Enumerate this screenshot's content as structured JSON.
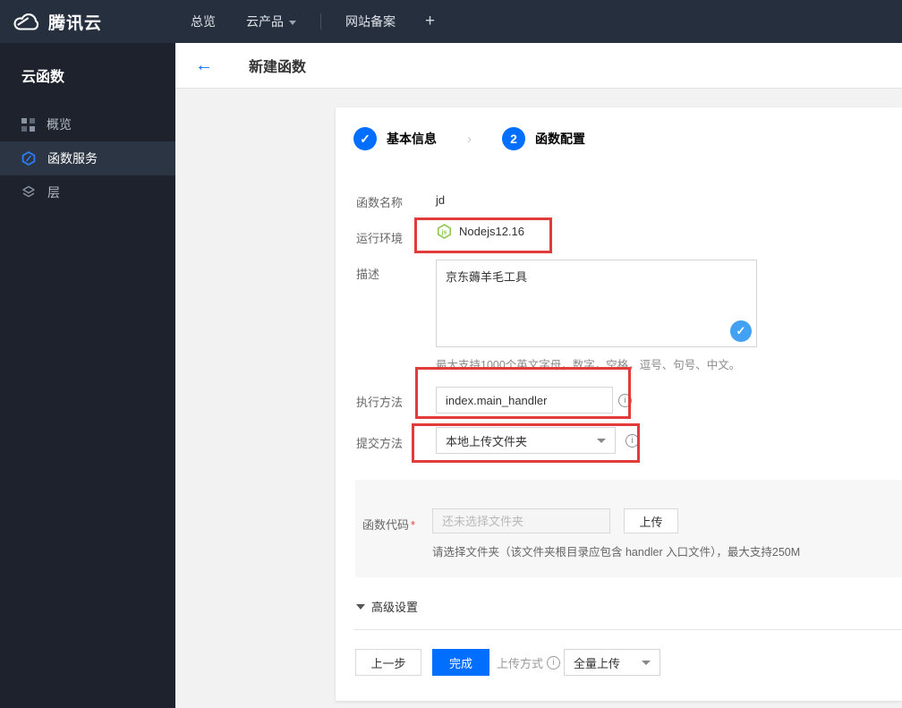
{
  "topnav": {
    "brand": "腾讯云",
    "overview": "总览",
    "products": "云产品",
    "icp": "网站备案",
    "plus": "+"
  },
  "sidebar": {
    "title": "云函数",
    "items": [
      {
        "label": "概览",
        "icon": "grid-icon",
        "active": false
      },
      {
        "label": "函数服务",
        "icon": "function-hexagon-icon",
        "active": true
      },
      {
        "label": "层",
        "icon": "layers-icon",
        "active": false
      }
    ]
  },
  "header": {
    "back": "←",
    "title": "新建函数"
  },
  "stepper": {
    "step1_label": "基本信息",
    "step1_check": "✓",
    "separator": "›",
    "step2_number": "2",
    "step2_label": "函数配置"
  },
  "form": {
    "name_label": "函数名称",
    "name_value": "jd",
    "runtime_label": "运行环境",
    "runtime_value": "Nodejs12.16",
    "desc_label": "描述",
    "desc_value": "京东薅羊毛工具",
    "desc_check": "✓",
    "desc_hint": "最大支持1000个英文字母，数字，空格，逗号、句号、中文。",
    "handler_label": "执行方法",
    "handler_value": "index.main_handler",
    "submit_label": "提交方法",
    "submit_value": "本地上传文件夹",
    "code_label": "函数代码",
    "required_mark": "*",
    "code_placeholder": "还未选择文件夹",
    "upload_button": "上传",
    "code_hint": "请选择文件夹（该文件夹根目录应包含 handler 入口文件），最大支持250M",
    "advanced_label": "高级设置",
    "info_glyph": "i"
  },
  "footer": {
    "prev": "上一步",
    "finish": "完成",
    "upload_mode_label": "上传方式",
    "upload_mode_value": "全量上传"
  },
  "colors": {
    "accent_blue": "#006eff",
    "annotation_red": "#e23b3b",
    "node_green": "#8cc84b",
    "check_blue": "#42a1f2",
    "nav_bg": "#262f3e",
    "sidebar_bg": "#1d222d",
    "page_bg": "#f2f2f2"
  }
}
